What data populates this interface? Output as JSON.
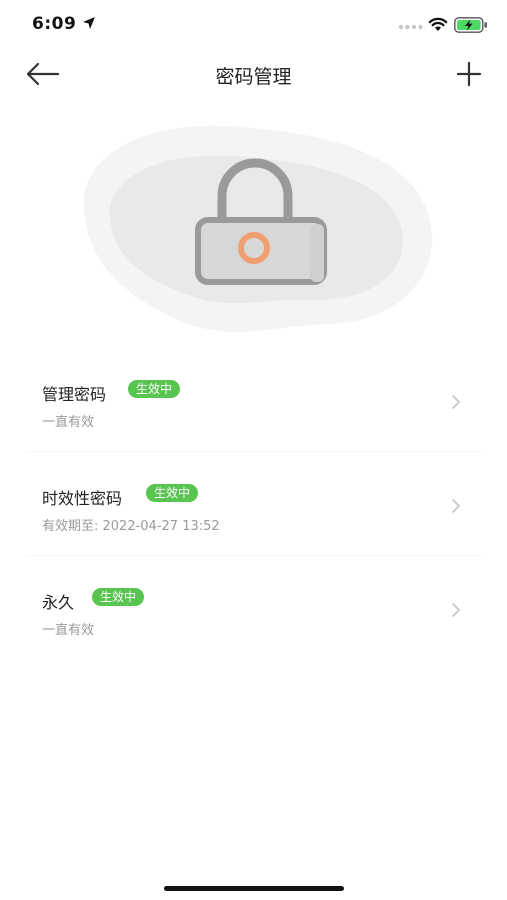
{
  "status_bar": {
    "time": "6:09"
  },
  "nav": {
    "title": "密码管理"
  },
  "passwords": [
    {
      "name": "管理密码",
      "status": "生效中",
      "validity": "一直有效"
    },
    {
      "name": "时效性密码",
      "status": "生效中",
      "validity": "有效期至: 2022-04-27 13:52"
    },
    {
      "name": "永久",
      "status": "生效中",
      "validity": "一直有效"
    }
  ],
  "colors": {
    "badge": "#5ac450",
    "lock_keyhole": "#f0a070",
    "lock_body": "#9a9a9a"
  }
}
